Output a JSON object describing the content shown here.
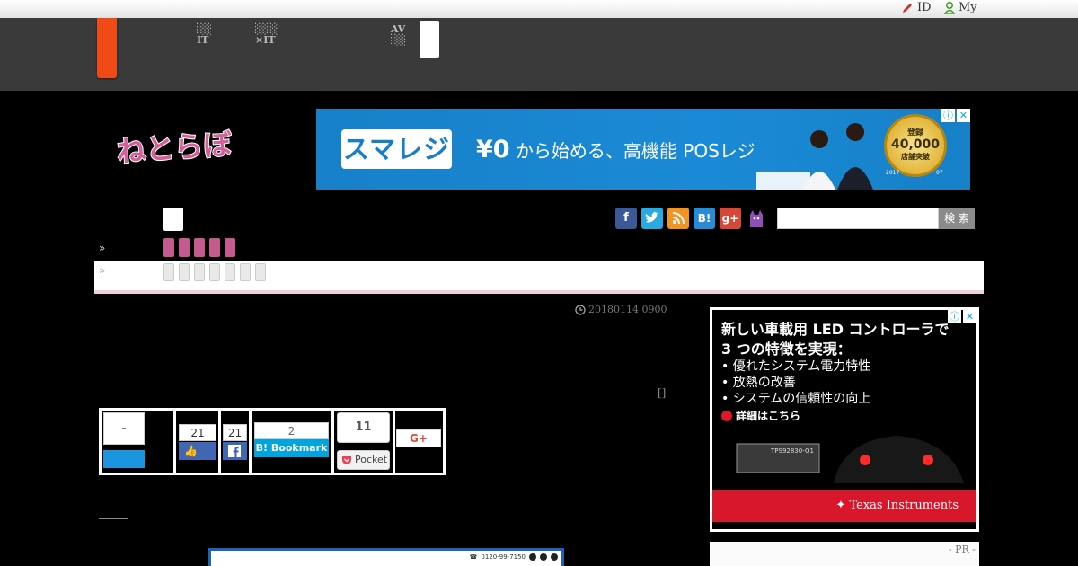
{
  "topbar": {
    "id_link": "ID",
    "my_link": "My"
  },
  "nav": {
    "item1": "░░\nIT",
    "item2": "░░░\n×IT",
    "item3": "AV\n░░"
  },
  "logo_text": "ねとらぼ",
  "top_ad": {
    "brand": "スマレジ",
    "price": "¥0",
    "tagline": "から始める、高機能 POSレジ",
    "badge_line1": "登録",
    "badge_number": "40,000",
    "badge_line2": "店舗突破",
    "badge_year": "2017",
    "badge_month": "07"
  },
  "search": {
    "button": "検 索"
  },
  "social_icons": [
    "f",
    "t",
    "rss",
    "B!",
    "g+",
    "cat"
  ],
  "article": {
    "date": "20180114 0900",
    "bracket": "[]"
  },
  "share": {
    "tweet_count": "-",
    "like_count": "21",
    "fb_share_count": "21",
    "hatena_count": "2",
    "hatena_label": "B! Bookmark",
    "pocket_count": "11",
    "pocket_label": "Pocket",
    "gplus_label": "G+"
  },
  "bottom_ad": {
    "phone": "0120-99-7150"
  },
  "side_ad": {
    "line1": "新しい車載用 LED コントローラで",
    "line2": "3 つの特徴を実現：",
    "bullet1": "• 優れたシステム電力特性",
    "bullet2": "• 放熱の改善",
    "bullet3": "• システムの信頼性の向上",
    "cta": "詳細はこちら",
    "chip": "TPS92830-Q1",
    "brand": "Texas Instruments"
  },
  "pr_label": "- PR -"
}
